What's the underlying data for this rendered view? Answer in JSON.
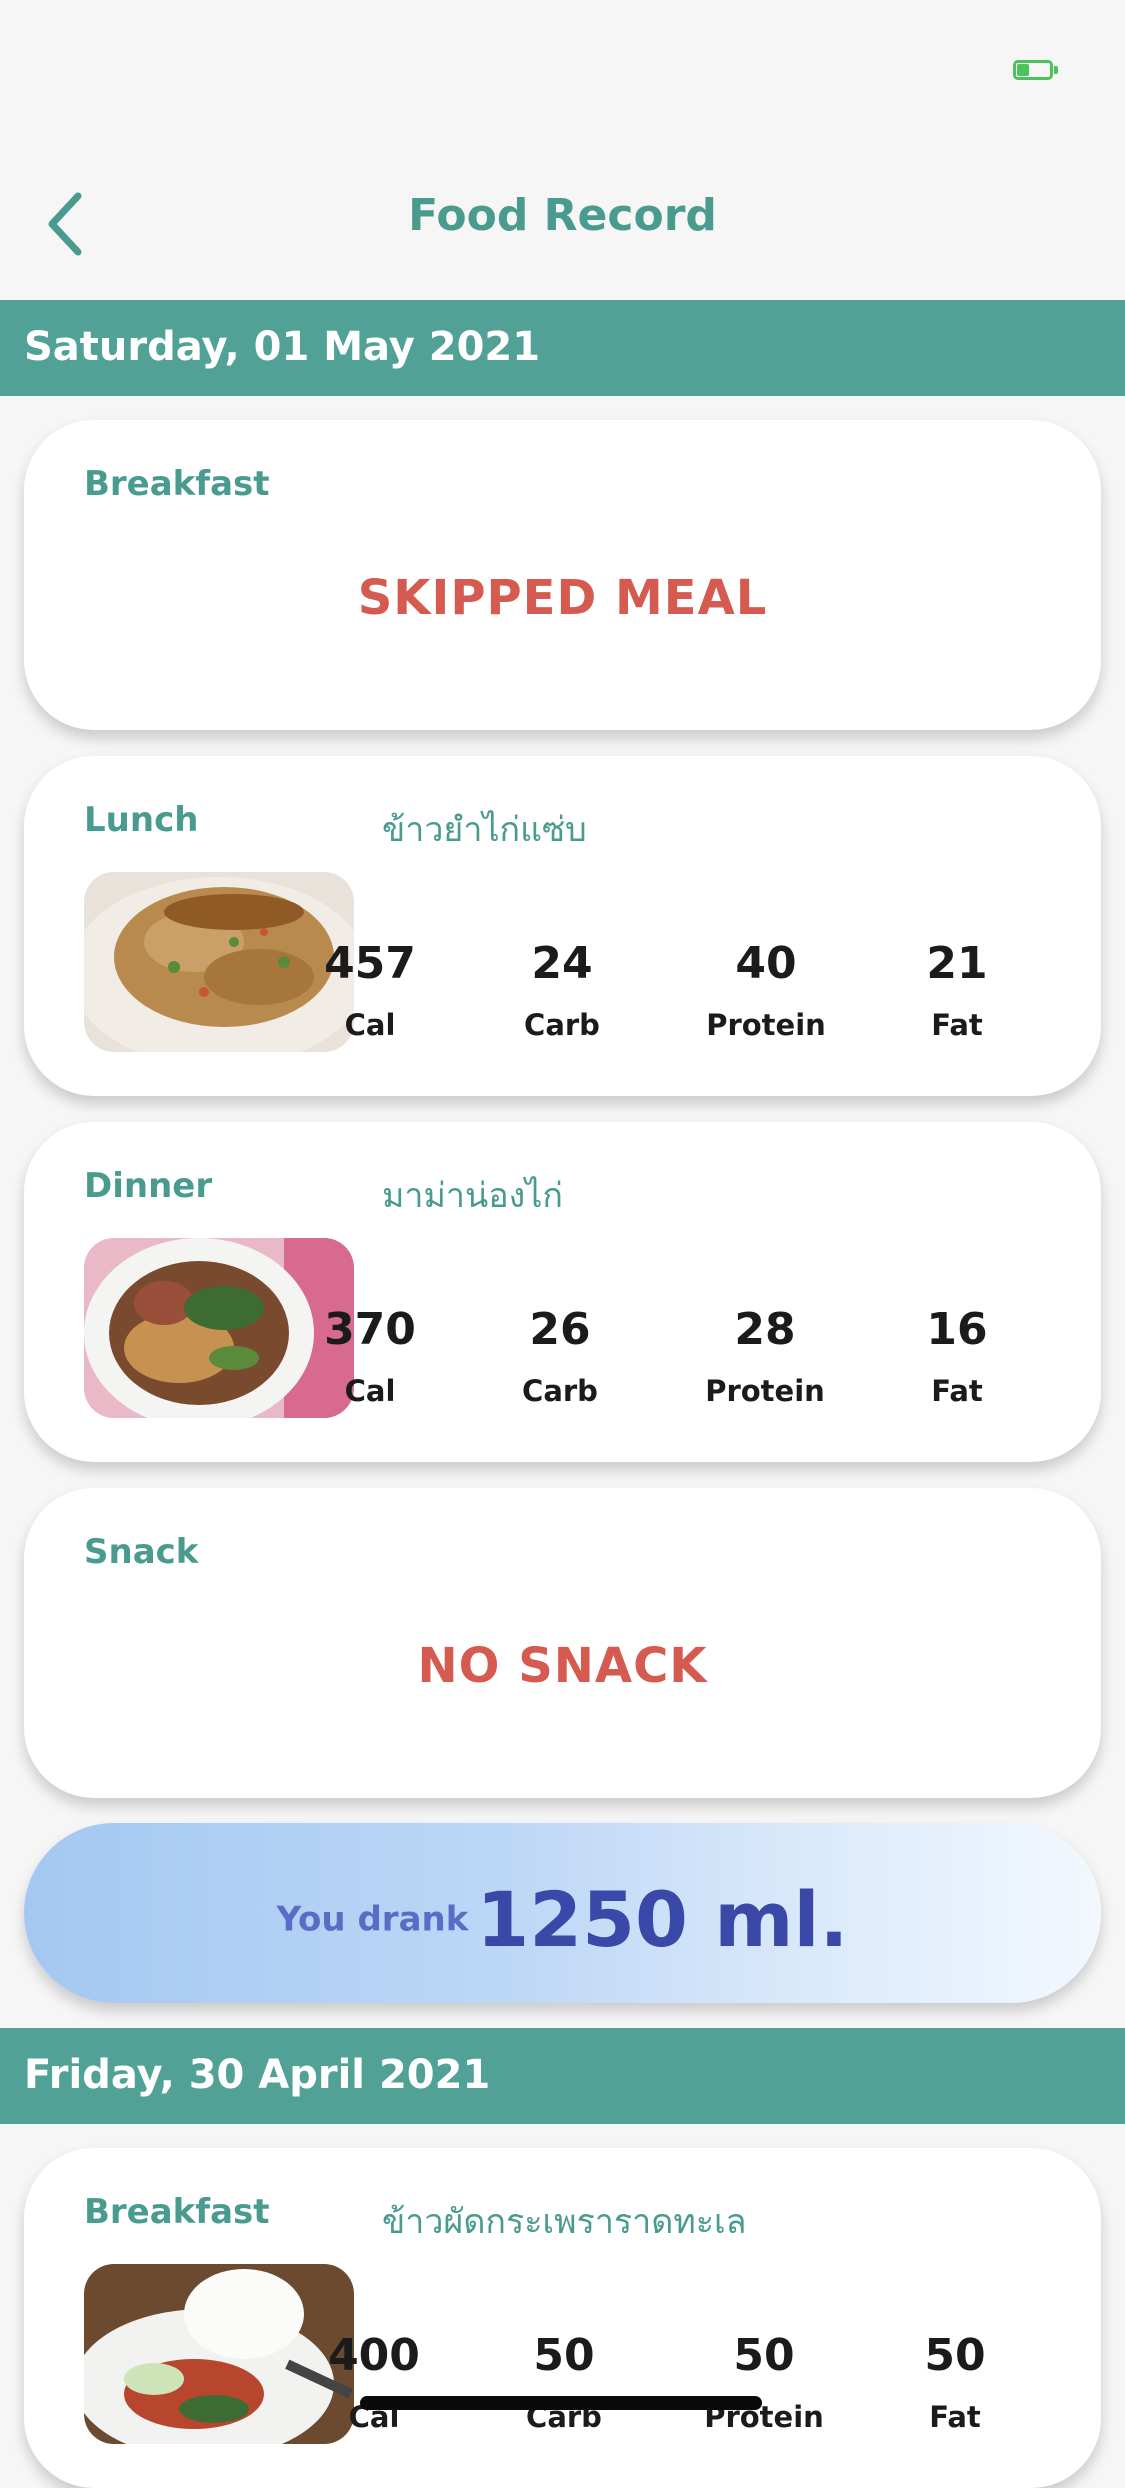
{
  "header": {
    "title": "Food Record"
  },
  "colors": {
    "accent": "#4a9b8f",
    "date_bar": "#52a196",
    "alert": "#d55a50",
    "water_text": "#3a48a8"
  },
  "days": [
    {
      "date": "Saturday, 01 May 2021",
      "breakfast": {
        "label": "Breakfast",
        "status": "SKIPPED MEAL"
      },
      "lunch": {
        "label": "Lunch",
        "food": "ข้าวยำไก่แซ่บ",
        "cal": "457",
        "carb": "24",
        "protein": "40",
        "fat": "21",
        "image": "crispy-chicken-rice-salad-photo"
      },
      "dinner": {
        "label": "Dinner",
        "food": "มาม่าน่องไก่",
        "cal": "370",
        "carb": "26",
        "protein": "28",
        "fat": "16",
        "image": "instant-noodle-chicken-drumstick-photo"
      },
      "snack": {
        "label": "Snack",
        "status": "NO SNACK"
      },
      "water": {
        "prefix": "You drank",
        "amount": "1250 ml."
      }
    },
    {
      "date": "Friday, 30 April 2021",
      "breakfast": {
        "label": "Breakfast",
        "food": "ข้าวผัดกระเพราราดทะเล",
        "cal": "400",
        "carb": "50",
        "protein": "50",
        "fat": "50",
        "image": "seafood-basil-rice-photo"
      }
    }
  ],
  "nutrient_labels": {
    "cal": "Cal",
    "carb": "Carb",
    "protein": "Protein",
    "fat": "Fat"
  },
  "icons": {
    "back": "chevron-left-icon",
    "battery": "battery-icon"
  }
}
